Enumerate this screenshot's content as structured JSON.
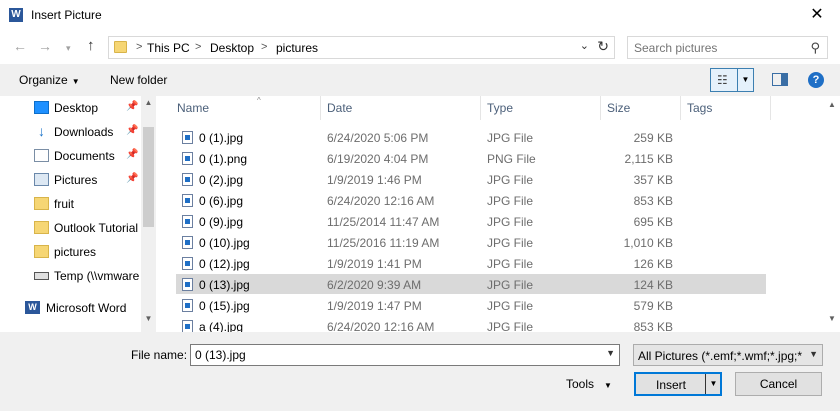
{
  "window": {
    "title": "Insert Picture",
    "app_icon": "word-icon",
    "close_glyph": "✕"
  },
  "nav": {
    "back": "←",
    "forward": "→",
    "recent": "▾",
    "up": "↑",
    "breadcrumb": [
      "This PC",
      "Desktop",
      "pictures"
    ],
    "separator": ">",
    "refresh": "↻",
    "dropdown": "⌄",
    "search_placeholder": "Search pictures",
    "search_icon": "⚲"
  },
  "toolbar": {
    "organize": "Organize",
    "new_folder": "New folder"
  },
  "sidebar": {
    "items": [
      {
        "label": "Desktop",
        "icon": "desktop-icon",
        "pinned": true
      },
      {
        "label": "Downloads",
        "icon": "download-icon",
        "pinned": true
      },
      {
        "label": "Documents",
        "icon": "documents-icon",
        "pinned": true
      },
      {
        "label": "Pictures",
        "icon": "pictures-icon",
        "pinned": true
      },
      {
        "label": "fruit",
        "icon": "folder-icon",
        "pinned": false
      },
      {
        "label": "Outlook Tutorial",
        "icon": "folder-icon",
        "pinned": false
      },
      {
        "label": "pictures",
        "icon": "folder-icon",
        "pinned": false
      },
      {
        "label": "Temp (\\\\vmware",
        "icon": "network-drive-icon",
        "pinned": false
      },
      {
        "label": "Microsoft Word",
        "icon": "word-icon",
        "pinned": false
      }
    ]
  },
  "columns": {
    "name": "Name",
    "date": "Date",
    "type": "Type",
    "size": "Size",
    "tags": "Tags"
  },
  "files": [
    {
      "name": "0 (1).jpg",
      "date": "6/24/2020 5:06 PM",
      "type": "JPG File",
      "size": "259 KB"
    },
    {
      "name": "0 (1).png",
      "date": "6/19/2020 4:04 PM",
      "type": "PNG File",
      "size": "2,115 KB"
    },
    {
      "name": "0 (2).jpg",
      "date": "1/9/2019 1:46 PM",
      "type": "JPG File",
      "size": "357 KB"
    },
    {
      "name": "0 (6).jpg",
      "date": "6/24/2020 12:16 AM",
      "type": "JPG File",
      "size": "853 KB"
    },
    {
      "name": "0 (9).jpg",
      "date": "11/25/2014 11:47 AM",
      "type": "JPG File",
      "size": "695 KB"
    },
    {
      "name": "0 (10).jpg",
      "date": "11/25/2016 11:19 AM",
      "type": "JPG File",
      "size": "1,010 KB"
    },
    {
      "name": "0 (12).jpg",
      "date": "1/9/2019 1:41 PM",
      "type": "JPG File",
      "size": "126 KB"
    },
    {
      "name": "0 (13).jpg",
      "date": "6/2/2020 9:39 AM",
      "type": "JPG File",
      "size": "124 KB",
      "selected": true
    },
    {
      "name": "0 (15).jpg",
      "date": "1/9/2019 1:47 PM",
      "type": "JPG File",
      "size": "579 KB"
    },
    {
      "name": "a (4).jpg",
      "date": "6/24/2020 12:16 AM",
      "type": "JPG File",
      "size": "853 KB"
    }
  ],
  "footer": {
    "filename_label": "File name:",
    "filename_value": "0 (13).jpg",
    "filter_value": "All Pictures (*.emf;*.wmf;*.jpg;*",
    "tools_label": "Tools",
    "insert_label": "Insert",
    "cancel_label": "Cancel"
  },
  "colors": {
    "accent": "#0078d7",
    "selected_row": "#d9d9d9",
    "word_blue": "#2b579a"
  }
}
